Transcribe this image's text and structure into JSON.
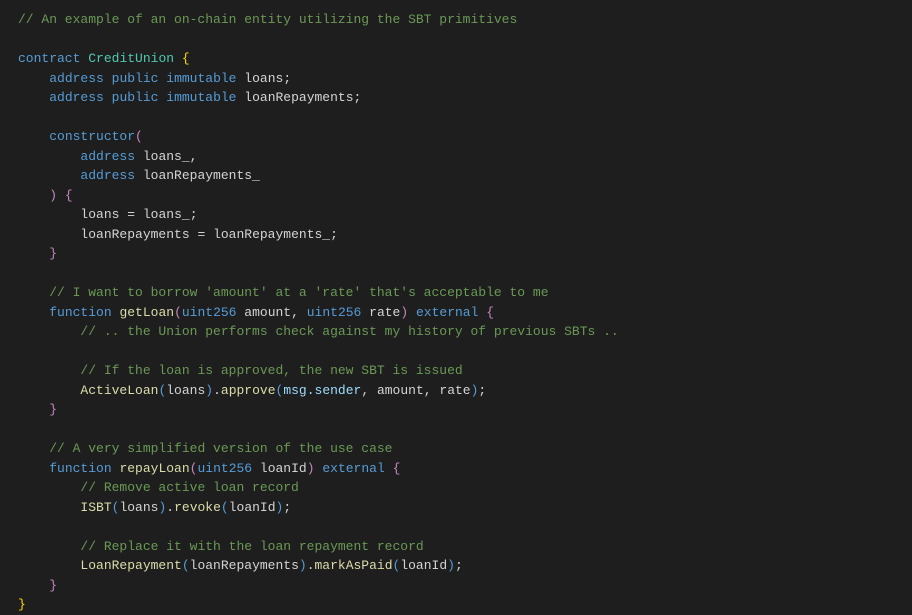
{
  "code": {
    "c1": "// An example of an on-chain entity utilizing the SBT primitives",
    "kw_contract": "contract",
    "name": "CreditUnion",
    "kw_address": "address",
    "kw_public": "public",
    "kw_immutable": "immutable",
    "var_loans": "loans",
    "var_loanRepayments": "loanRepayments",
    "kw_constructor": "constructor",
    "param_loans": "loans_",
    "param_loanRepayments": "loanRepayments_",
    "assign1_lhs": "loans",
    "assign1_rhs": "loans_",
    "assign2_lhs": "loanRepayments",
    "assign2_rhs": "loanRepayments_",
    "c2": "// I want to borrow 'amount' at a 'rate' that's acceptable to me",
    "kw_function": "function",
    "fn_getLoan": "getLoan",
    "t_uint256": "uint256",
    "p_amount": "amount",
    "p_rate": "rate",
    "kw_external": "external",
    "c3": "// .. the Union performs check against my history of previous SBTs ..",
    "c4": "// If the loan is approved, the new SBT is issued",
    "ActiveLoan": "ActiveLoan",
    "approve": "approve",
    "msg_sender": "msg.sender",
    "c5": "// A very simplified version of the use case",
    "fn_repayLoan": "repayLoan",
    "p_loanId": "loanId",
    "c6": "// Remove active loan record",
    "ISBT": "ISBT",
    "revoke": "revoke",
    "c7": "// Replace it with the loan repayment record",
    "LoanRepayment": "LoanRepayment",
    "markAsPaid": "markAsPaid"
  }
}
